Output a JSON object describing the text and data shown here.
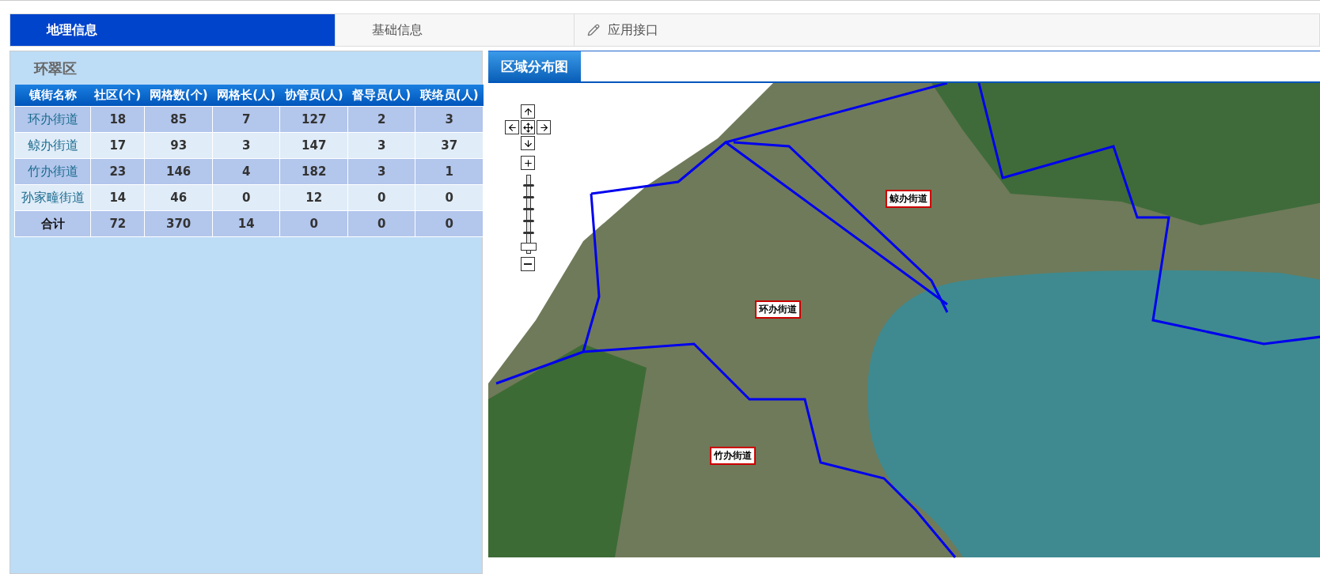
{
  "tabs": [
    {
      "label": "地理信息",
      "selected": true,
      "kind": "plain"
    },
    {
      "label": "基础信息",
      "selected": false,
      "kind": "plain"
    },
    {
      "label": "应用接口",
      "selected": false,
      "kind": "with-icon"
    }
  ],
  "district": {
    "title": "环翠区",
    "table": {
      "columns": [
        "镇街名称",
        "社区(个)",
        "网格数(个)",
        "网格长(人)",
        "协管员(人)",
        "督导员(人)",
        "联络员(人)"
      ],
      "rows": [
        {
          "kind": "street",
          "cells": [
            "环办街道",
            "18",
            "85",
            "7",
            "127",
            "2",
            "3"
          ]
        },
        {
          "kind": "street",
          "cells": [
            "鲸办街道",
            "17",
            "93",
            "3",
            "147",
            "3",
            "37"
          ]
        },
        {
          "kind": "street",
          "cells": [
            "竹办街道",
            "23",
            "146",
            "4",
            "182",
            "3",
            "1"
          ]
        },
        {
          "kind": "street",
          "cells": [
            "孙家疃街道",
            "14",
            "46",
            "0",
            "12",
            "0",
            "0"
          ]
        },
        {
          "kind": "total",
          "cells": [
            "合计",
            "72",
            "370",
            "14",
            "0",
            "0",
            "0"
          ]
        }
      ]
    }
  },
  "map": {
    "tabs": [
      {
        "label": "区域分布图",
        "selected": true
      }
    ],
    "zoom_slider": {
      "level": 0.05
    },
    "labels": [
      "鲸办街道",
      "环办街道",
      "竹办街道"
    ]
  }
}
